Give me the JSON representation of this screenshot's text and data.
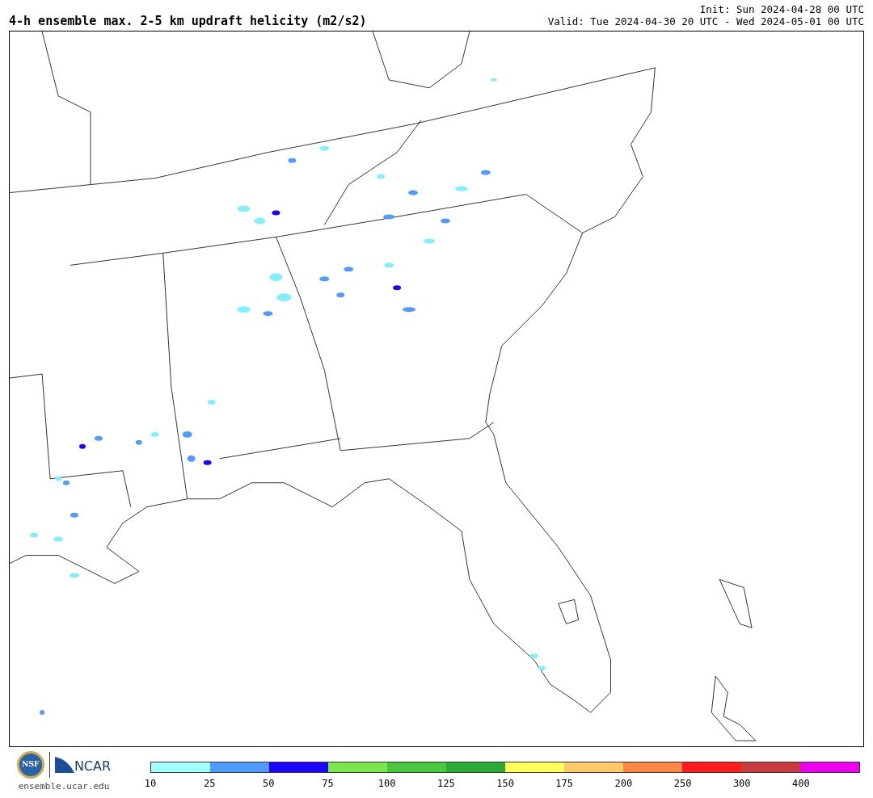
{
  "title": "4-h ensemble max. 2-5 km updraft helicity (m2/s2)",
  "init": "Init: Sun 2024-04-28 00 UTC",
  "valid": "Valid: Tue 2024-04-30 20 UTC - Wed 2024-05-01 00 UTC",
  "logos": {
    "nsf": "NSF",
    "ncar": "NCAR",
    "site": "ensemble.ucar.edu"
  },
  "colorbar": {
    "bins": [
      {
        "color": "#a0ffff"
      },
      {
        "color": "#4f9bff"
      },
      {
        "color": "#1a06ff"
      },
      {
        "color": "#7ae64e"
      },
      {
        "color": "#4ac83e"
      },
      {
        "color": "#2aab34"
      },
      {
        "color": "#ffff5a"
      },
      {
        "color": "#ffc96a"
      },
      {
        "color": "#ff8645"
      },
      {
        "color": "#ff1c1c"
      },
      {
        "color": "#c83c3c"
      },
      {
        "color": "#f000f0"
      }
    ],
    "ticks": [
      "10",
      "25",
      "50",
      "75",
      "100",
      "125",
      "150",
      "175",
      "200",
      "250",
      "300",
      "400"
    ]
  }
}
